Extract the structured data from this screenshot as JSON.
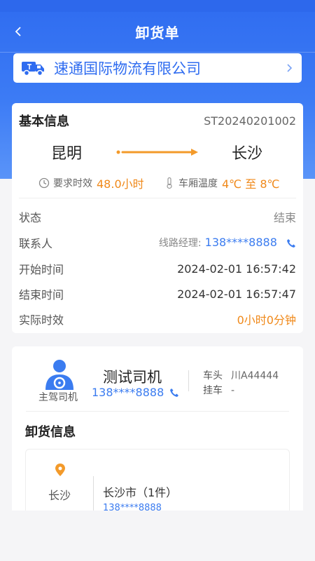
{
  "nav": {
    "title": "卸货单"
  },
  "company": {
    "name": "速通国际物流有限公司"
  },
  "basic": {
    "title": "基本信息",
    "order_no": "ST20240201002",
    "from_city": "昆明",
    "to_city": "长沙",
    "req_time_label": "要求时效",
    "req_time_value": "48.0小时",
    "temp_label": "车厢温度",
    "temp_value": "4℃ 至 8℃",
    "rows": [
      {
        "label": "状态",
        "value": "结束"
      },
      {
        "label": "联系人",
        "prefix": "线路经理:",
        "value": "138****8888"
      },
      {
        "label": "开始时间",
        "value": "2024-02-01 16:57:42"
      },
      {
        "label": "结束时间",
        "value": "2024-02-01 16:57:47"
      },
      {
        "label": "实际时效",
        "value": "0小时0分钟"
      }
    ]
  },
  "driver": {
    "role": "主驾司机",
    "name": "测试司机",
    "phone": "138****8888",
    "head_label": "车头",
    "head_value": "川A44444",
    "trailer_label": "挂车",
    "trailer_value": "-"
  },
  "unload": {
    "title": "卸货信息",
    "city": "长沙",
    "dest": "长沙市（1件）",
    "phone": "138****8888"
  },
  "colors": {
    "primary": "#2f6cf0",
    "accent": "#f0891a",
    "link": "#3b7cf0"
  },
  "icons": [
    "back-icon",
    "truck-icon",
    "chevron-right-icon",
    "clock-icon",
    "thermometer-icon",
    "phone-icon",
    "driver-avatar-icon",
    "location-pin-icon"
  ]
}
